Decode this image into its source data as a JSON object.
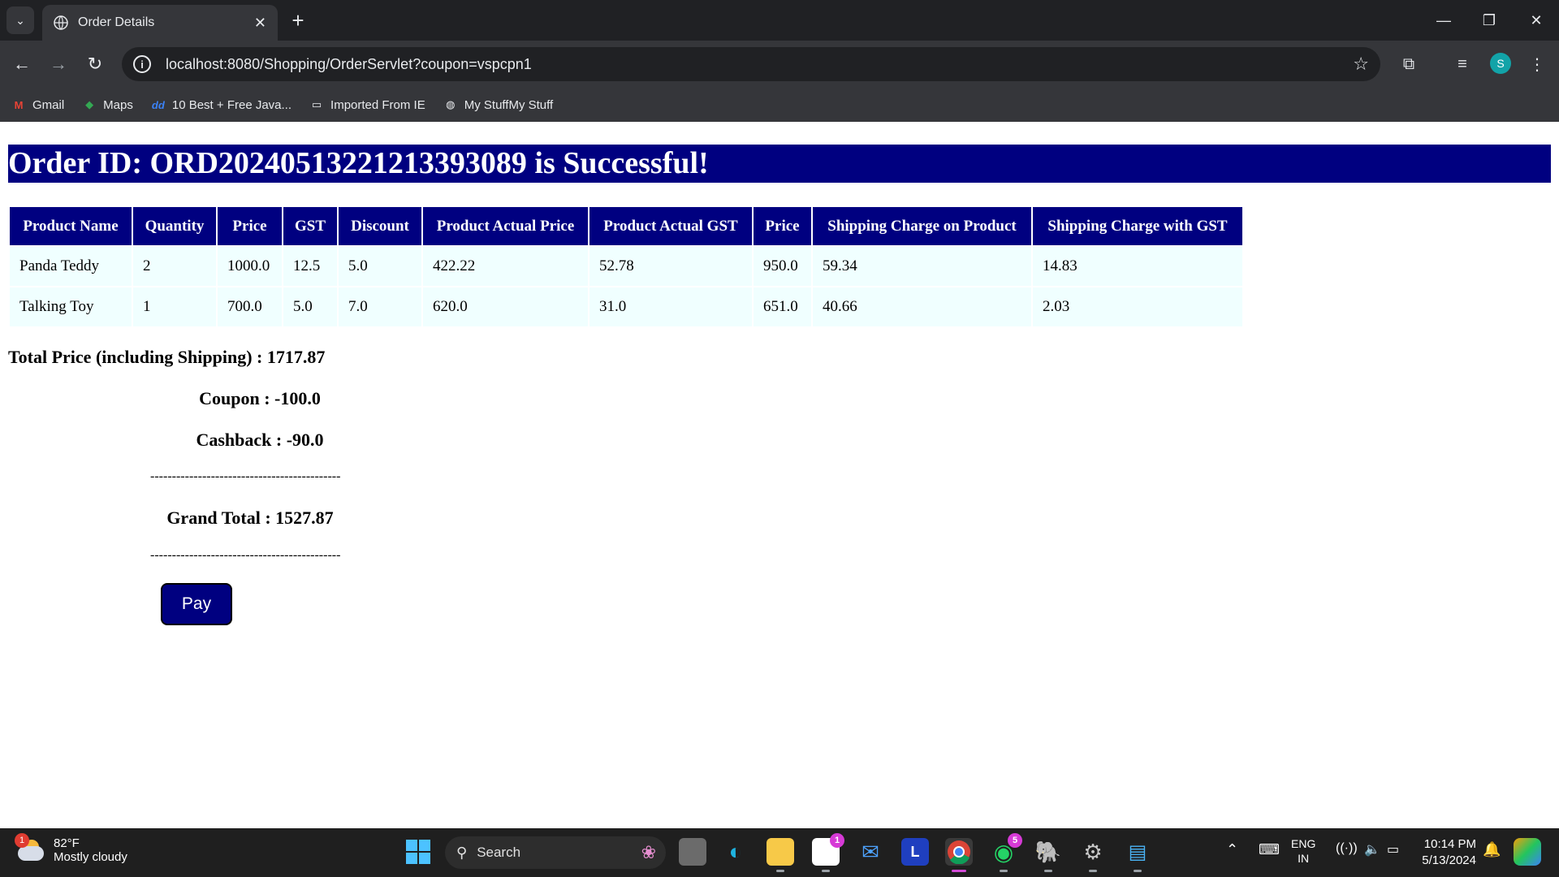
{
  "browser": {
    "tab_title": "Order Details",
    "url": "localhost:8080/Shopping/OrderServlet?coupon=vspcpn1",
    "profile_initial": "S",
    "bookmarks": [
      "Gmail",
      "Maps",
      "10 Best + Free Java...",
      "Imported From IE",
      "My StuffMy Stuff"
    ]
  },
  "page": {
    "heading": "Order ID: ORD20240513221213393089 is Successful!",
    "table": {
      "headers": [
        "Product Name",
        "Quantity",
        "Price",
        "GST",
        "Discount",
        "Product Actual Price",
        "Product Actual GST",
        "Price",
        "Shipping Charge on Product",
        "Shipping Charge with GST"
      ],
      "rows": [
        [
          "Panda Teddy",
          "2",
          "1000.0",
          "12.5",
          "5.0",
          "422.22",
          "52.78",
          "950.0",
          "59.34",
          "14.83"
        ],
        [
          "Talking Toy",
          "1",
          "700.0",
          "5.0",
          "7.0",
          "620.0",
          "31.0",
          "651.0",
          "40.66",
          "2.03"
        ]
      ]
    },
    "total_price": "Total Price (including Shipping) : 1717.87",
    "coupon": "Coupon : -100.0",
    "cashback": "Cashback : -90.0",
    "separator": "--------------------------------------------",
    "grand_total": "Grand Total : 1527.87",
    "pay_button": "Pay"
  },
  "taskbar": {
    "weather_temp": "82°F",
    "weather_desc": "Mostly cloudy",
    "weather_badge": "1",
    "search_placeholder": "Search",
    "store_badge": "1",
    "whatsapp_badge": "5",
    "launcher_letter": "L",
    "language_line1": "ENG",
    "language_line2": "IN",
    "time": "10:14 PM",
    "date": "5/13/2024"
  }
}
